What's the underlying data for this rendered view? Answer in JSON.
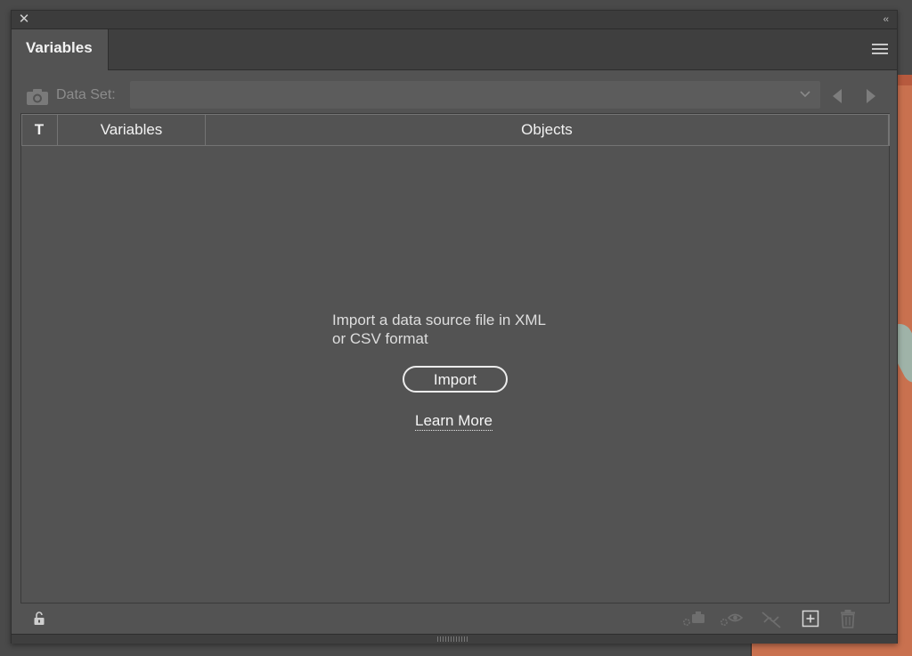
{
  "panel": {
    "tab_label": "Variables",
    "collapse_label": "‹‹"
  },
  "dataset": {
    "label": "Data Set:",
    "selected_value": ""
  },
  "table": {
    "columns": [
      "T",
      "Variables",
      "Objects"
    ]
  },
  "empty_state": {
    "message_line1": "Import a data source file in XML",
    "message_line2": "or CSV format",
    "import_label": "Import",
    "learn_more_label": "Learn More"
  },
  "colors": {
    "panel_bg": "#535353",
    "titlebar_bg": "#3c3c3c",
    "canvas_bg": "#c9714f"
  },
  "footer_icons": [
    "unlock-icon",
    "capture-dataset-icon",
    "make-visible-icon",
    "unbind-icon",
    "new-variable-icon",
    "trash-icon"
  ]
}
